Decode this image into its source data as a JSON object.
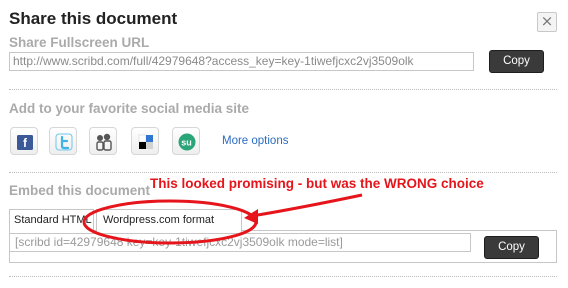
{
  "dialog": {
    "title": "Share this document",
    "close_label": "×"
  },
  "fullscreen": {
    "label": "Share Fullscreen URL",
    "url_value": "http://www.scribd.com/full/42979648?access_key=key-1tiwefjcxc2vj3509olk",
    "copy_label": "Copy"
  },
  "social": {
    "label": "Add to your favorite social media site",
    "icons": [
      "facebook-icon",
      "twitter-icon",
      "myspace-icon",
      "delicious-icon",
      "stumbleupon-icon"
    ],
    "more_label": "More options"
  },
  "embed": {
    "label": "Embed this document",
    "tabs": [
      {
        "label": "Standard HTML",
        "selected": false
      },
      {
        "label": "Wordpress.com format",
        "selected": true
      }
    ],
    "code_value": "[scribd id=42979648 key=key-1tiwefjcxc2vj3509olk mode=list]",
    "copy_label": "Copy"
  },
  "annotation": {
    "text": "This looked promising - but was the WRONG choice",
    "color": "#e5151b"
  },
  "colors": {
    "button_bg": "#3a3a3a",
    "section_label": "#aaaaaa",
    "link": "#2a6cbe"
  }
}
